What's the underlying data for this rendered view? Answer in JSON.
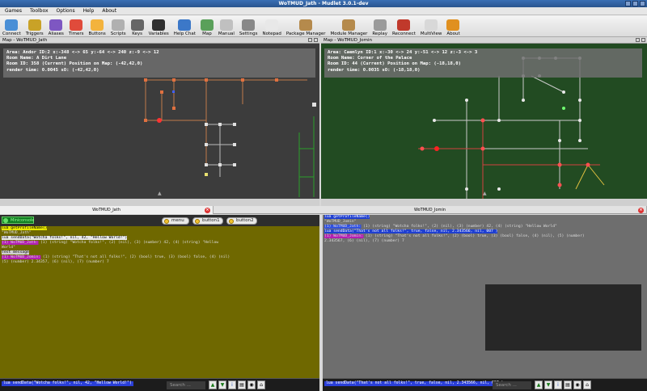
{
  "window": {
    "title": "WoTMUD_Jath - Mudlet 3.0.1-dev"
  },
  "menubar": {
    "items": [
      "Games",
      "Toolbox",
      "Options",
      "Help",
      "About"
    ]
  },
  "toolbar": {
    "buttons": [
      {
        "label": "Connect",
        "icon": "connect-icon",
        "color": "#4a8fd6"
      },
      {
        "label": "Triggers",
        "icon": "triggers-icon",
        "color": "#c9a227"
      },
      {
        "label": "Aliases",
        "icon": "aliases-icon",
        "color": "#7e57c2"
      },
      {
        "label": "Timers",
        "icon": "timers-icon",
        "color": "#e04b3b"
      },
      {
        "label": "Buttons",
        "icon": "buttons-icon",
        "color": "#f3b33d"
      },
      {
        "label": "Scripts",
        "icon": "scripts-icon",
        "color": "#b0b0b0"
      },
      {
        "label": "Keys",
        "icon": "keys-icon",
        "color": "#666666"
      },
      {
        "label": "Variables",
        "icon": "variables-icon",
        "color": "#303030"
      },
      {
        "label": "Help Chat",
        "icon": "help-chat-icon",
        "color": "#3c78c8"
      },
      {
        "label": "Map",
        "icon": "map-icon",
        "color": "#5aa05a"
      },
      {
        "label": "Manual",
        "icon": "manual-icon",
        "color": "#c0c0c0"
      },
      {
        "label": "Settings",
        "icon": "settings-icon",
        "color": "#888888"
      },
      {
        "label": "Notepad",
        "icon": "notepad-icon",
        "color": "#e8e8e8"
      },
      {
        "label": "Package Manager",
        "icon": "package-manager-icon",
        "color": "#b58a4c"
      },
      {
        "label": "Module Manager",
        "icon": "module-manager-icon",
        "color": "#b58a4c"
      },
      {
        "label": "Replay",
        "icon": "replay-icon",
        "color": "#9a9a9a"
      },
      {
        "label": "Reconnect",
        "icon": "reconnect-icon",
        "color": "#c0392b"
      },
      {
        "label": "MultiView",
        "icon": "multiview-icon",
        "color": "#d8d8d8"
      },
      {
        "label": "About",
        "icon": "about-icon",
        "color": "#e09020"
      }
    ]
  },
  "mapLeft": {
    "header": "Map - WoTMUD_Jath",
    "info": [
      "Area: Andor ID:2 x:-348 <-> 65 y:-64 <-> 240 z:-9 <-> 12",
      "Room Name: A Dirt Lane",
      "Room ID: 358 (Current) Position on Map: (-42,42,0)",
      "render time: 0.0045 sO: (-42,42,0)"
    ]
  },
  "mapRight": {
    "header": "Map - WoTMUD_Jomin",
    "info": [
      "Area: Caemlyn ID:1 x:-30 <-> 24 y:-51 <-> 12 z:-3 <-> 3",
      "Room Name: Corner of the Palace",
      "Room ID: 44 (Current) Position on Map: (-18,18,0)",
      "render time: 0.0035 sO: (-18,18,0)"
    ]
  },
  "tabs": [
    {
      "label": "WoTMUD_Jath"
    },
    {
      "label": "WoTMUD_Jomin"
    }
  ],
  "consoleLeft": {
    "miniconsole_label": "Miniconsole",
    "buttons": {
      "menu": "menu",
      "button1": "button1",
      "button2": "button2"
    },
    "lines": [
      {
        "text": "lua getProfileName()",
        "bg": "#e8e800",
        "fg": "#000"
      },
      {
        "text": "\"WoTMUD_Jath\"",
        "bg": "",
        "fg": "#ddd"
      },
      {
        "text": "",
        "bg": "",
        "fg": "#ddd"
      },
      {
        "text": "lua sendData(\"Wotcha folks!\", nil, 42, \"Hellow World!\")",
        "bg": "#e8e8e8",
        "fg": "#000"
      },
      {
        "text": "(1) WoTMUD_Jath: (1) (string) \"Wotcha folks!\", (2) (nil), (3) (number) 42, (4) (string) \"Hellow",
        "bg": "",
        "fg": "#ddd",
        "tag": "#b21fb2",
        "taglen": 16
      },
      {
        "text": "World\"",
        "bg": "",
        "fg": "#ddd"
      },
      {
        "text": "Test message",
        "bg": "#d0d0d0",
        "fg": "#000"
      },
      {
        "text": "",
        "bg": "",
        "fg": "#ddd"
      },
      {
        "text": "(1) WoTMUD_Jomin: (1) (string) \"That's not all folks!\", (2) (bool) true, (3) (bool) false, (4) (nil)",
        "bg": "",
        "fg": "#ddd",
        "tag": "#b21fb2",
        "taglen": 17
      },
      {
        "text": "  (5) (number) 2.34357, (6) (nil), (7) (number) 7",
        "bg": "",
        "fg": "#ddd"
      }
    ],
    "command": "lua sendData(\"Wotcha folks!\", nil, 42, \"Hellow World!\")",
    "search_placeholder": "Search ..."
  },
  "consoleRight": {
    "lines": [
      {
        "text": "lua getProfileName()",
        "bg": "#1f3fd0",
        "fg": "#fff"
      },
      {
        "text": "\"WoTMUD_Jomin\"",
        "bg": "",
        "fg": "#ddd"
      },
      {
        "text": "",
        "bg": "",
        "fg": "#ddd"
      },
      {
        "text": "(1) WoTMUD_Jath:    (1) (string) \"Wotcha folks!\",  (2) (nil),  (3) (number) 42,  (4) (string) \"Hellow World\"",
        "bg": "",
        "fg": "#ddd",
        "tag": "#3050e0",
        "taglen": 16
      },
      {
        "text": "lua sendData(\"That's not all folks!\", true, false, nil, 2.343566, nil, 007 )",
        "bg": "#1f3fd0",
        "fg": "#fff"
      },
      {
        "text": "",
        "bg": "",
        "fg": "#ddd"
      },
      {
        "text": "(1) WoTMUD_Jomin:    (1) (string) \"That's not all folks!\",  (2) (bool) true,  (3) (bool) false,  (4) (nil),  (5) (number)",
        "bg": "",
        "fg": "#ddd",
        "tag": "#b21fb2",
        "taglen": 17
      },
      {
        "text": "2.343567,  (6) (nil),  (7) (number) 7",
        "bg": "",
        "fg": "#ddd"
      }
    ],
    "command": "lua sendData(\"That's not all folks!\", true, false, nil, 2.343566, nil, 007 )",
    "search_placeholder": "Search ..."
  }
}
